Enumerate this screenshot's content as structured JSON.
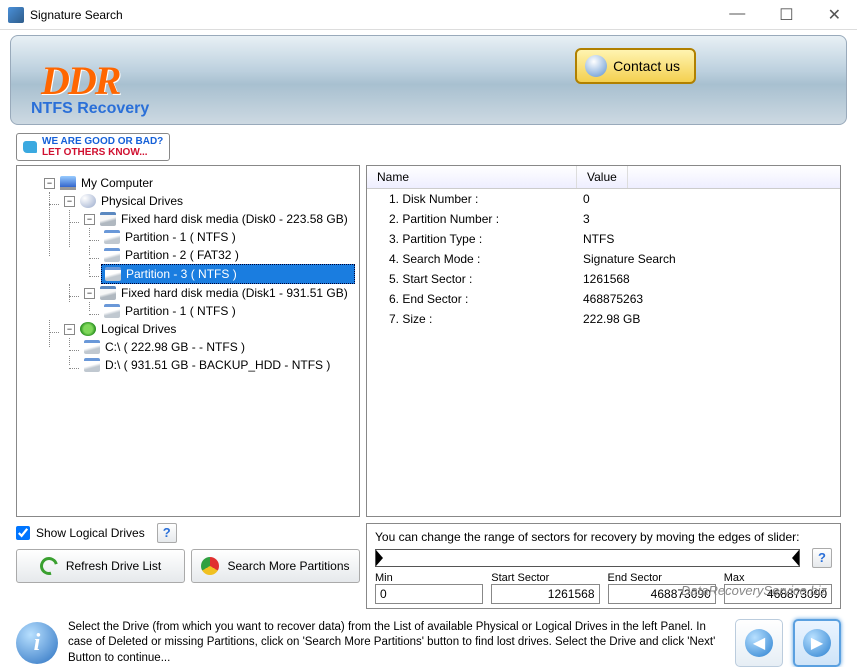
{
  "window": {
    "title": "Signature Search"
  },
  "header": {
    "logo": "DDR",
    "subtitle": "NTFS Recovery",
    "contact_label": "Contact us"
  },
  "feedback": {
    "line1": "WE ARE GOOD OR BAD?",
    "line2": "LET OTHERS KNOW..."
  },
  "tree": {
    "root": "My Computer",
    "physical_label": "Physical Drives",
    "disks": [
      {
        "label": "Fixed hard disk media (Disk0 - 223.58 GB)",
        "partitions": [
          {
            "label": "Partition - 1 ( NTFS )"
          },
          {
            "label": "Partition - 2 ( FAT32 )"
          },
          {
            "label": "Partition - 3 ( NTFS )",
            "selected": true
          }
        ]
      },
      {
        "label": "Fixed hard disk media (Disk1 - 931.51 GB)",
        "partitions": [
          {
            "label": "Partition - 1 ( NTFS )"
          }
        ]
      }
    ],
    "logical_label": "Logical Drives",
    "logical": [
      {
        "label": "C:\\ ( 222.98 GB -  - NTFS )"
      },
      {
        "label": "D:\\ ( 931.51 GB - BACKUP_HDD - NTFS )"
      }
    ]
  },
  "props": {
    "head_name": "Name",
    "head_value": "Value",
    "rows": [
      {
        "name": "1. Disk Number :",
        "value": "0"
      },
      {
        "name": "2. Partition Number :",
        "value": "3"
      },
      {
        "name": "3. Partition Type :",
        "value": "NTFS"
      },
      {
        "name": "4. Search Mode :",
        "value": "Signature Search"
      },
      {
        "name": "5. Start Sector :",
        "value": "1261568"
      },
      {
        "name": "6. End Sector :",
        "value": "468875263"
      },
      {
        "name": "7. Size :",
        "value": "222.98 GB"
      }
    ]
  },
  "controls": {
    "show_logical": "Show Logical Drives",
    "refresh": "Refresh Drive List",
    "search_more": "Search More Partitions"
  },
  "slider": {
    "hint": "You can change the range of sectors for recovery by moving the edges of slider:",
    "min_label": "Min",
    "min_value": "0",
    "start_label": "Start Sector",
    "start_value": "1261568",
    "end_label": "End Sector",
    "end_value": "468873090",
    "max_label": "Max",
    "max_value": "468873090"
  },
  "footer": {
    "text": "Select the Drive (from which you want to recover data) from the List of available Physical or Logical Drives in the left Panel. In case of Deleted or missing Partitions, click on 'Search More Partitions' button to find lost drives. Select the Drive and click 'Next' Button to continue..."
  },
  "watermark": "DataRecoveryService.biz"
}
